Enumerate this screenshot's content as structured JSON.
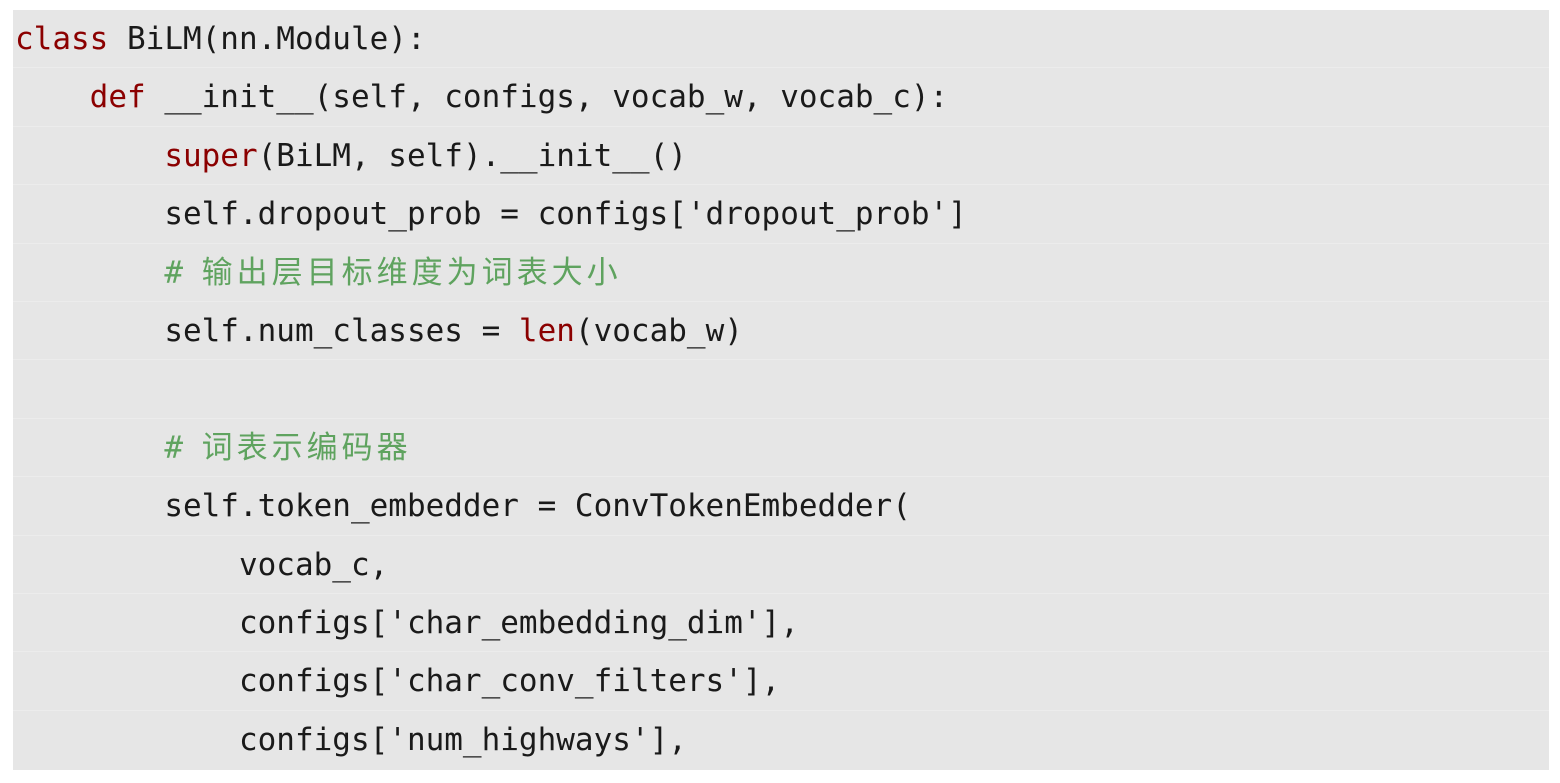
{
  "code": {
    "line_1": {
      "kw": "class",
      "rest": " BiLM(nn.Module):"
    },
    "line_2": {
      "indent": "    ",
      "kw": "def",
      "rest": " __init__(self, configs, vocab_w, vocab_c):"
    },
    "line_3": {
      "indent": "        ",
      "builtin": "super",
      "rest": "(BiLM, self).__init__()"
    },
    "line_4": {
      "indent": "        ",
      "rest": "self.dropout_prob = configs['dropout_prob']"
    },
    "line_5": {
      "indent": "        ",
      "hash": "# ",
      "comment": "输出层目标维度为词表大小"
    },
    "line_6": {
      "indent": "        ",
      "pre": "self.num_classes = ",
      "builtin": "len",
      "post": "(vocab_w)"
    },
    "line_7": {
      "text": ""
    },
    "line_8": {
      "indent": "        ",
      "hash": "# ",
      "comment": "词表示编码器"
    },
    "line_9": {
      "indent": "        ",
      "rest": "self.token_embedder = ConvTokenEmbedder("
    },
    "line_10": {
      "indent": "            ",
      "rest": "vocab_c,"
    },
    "line_11": {
      "indent": "            ",
      "rest": "configs['char_embedding_dim'],"
    },
    "line_12": {
      "indent": "            ",
      "rest": "configs['char_conv_filters'],"
    },
    "line_13": {
      "indent": "            ",
      "rest": "configs['num_highways'],"
    }
  },
  "colors": {
    "background": "#e6e6e6",
    "keyword": "#8b0000",
    "comment": "#5fa35f",
    "text": "#1a1a1a"
  }
}
